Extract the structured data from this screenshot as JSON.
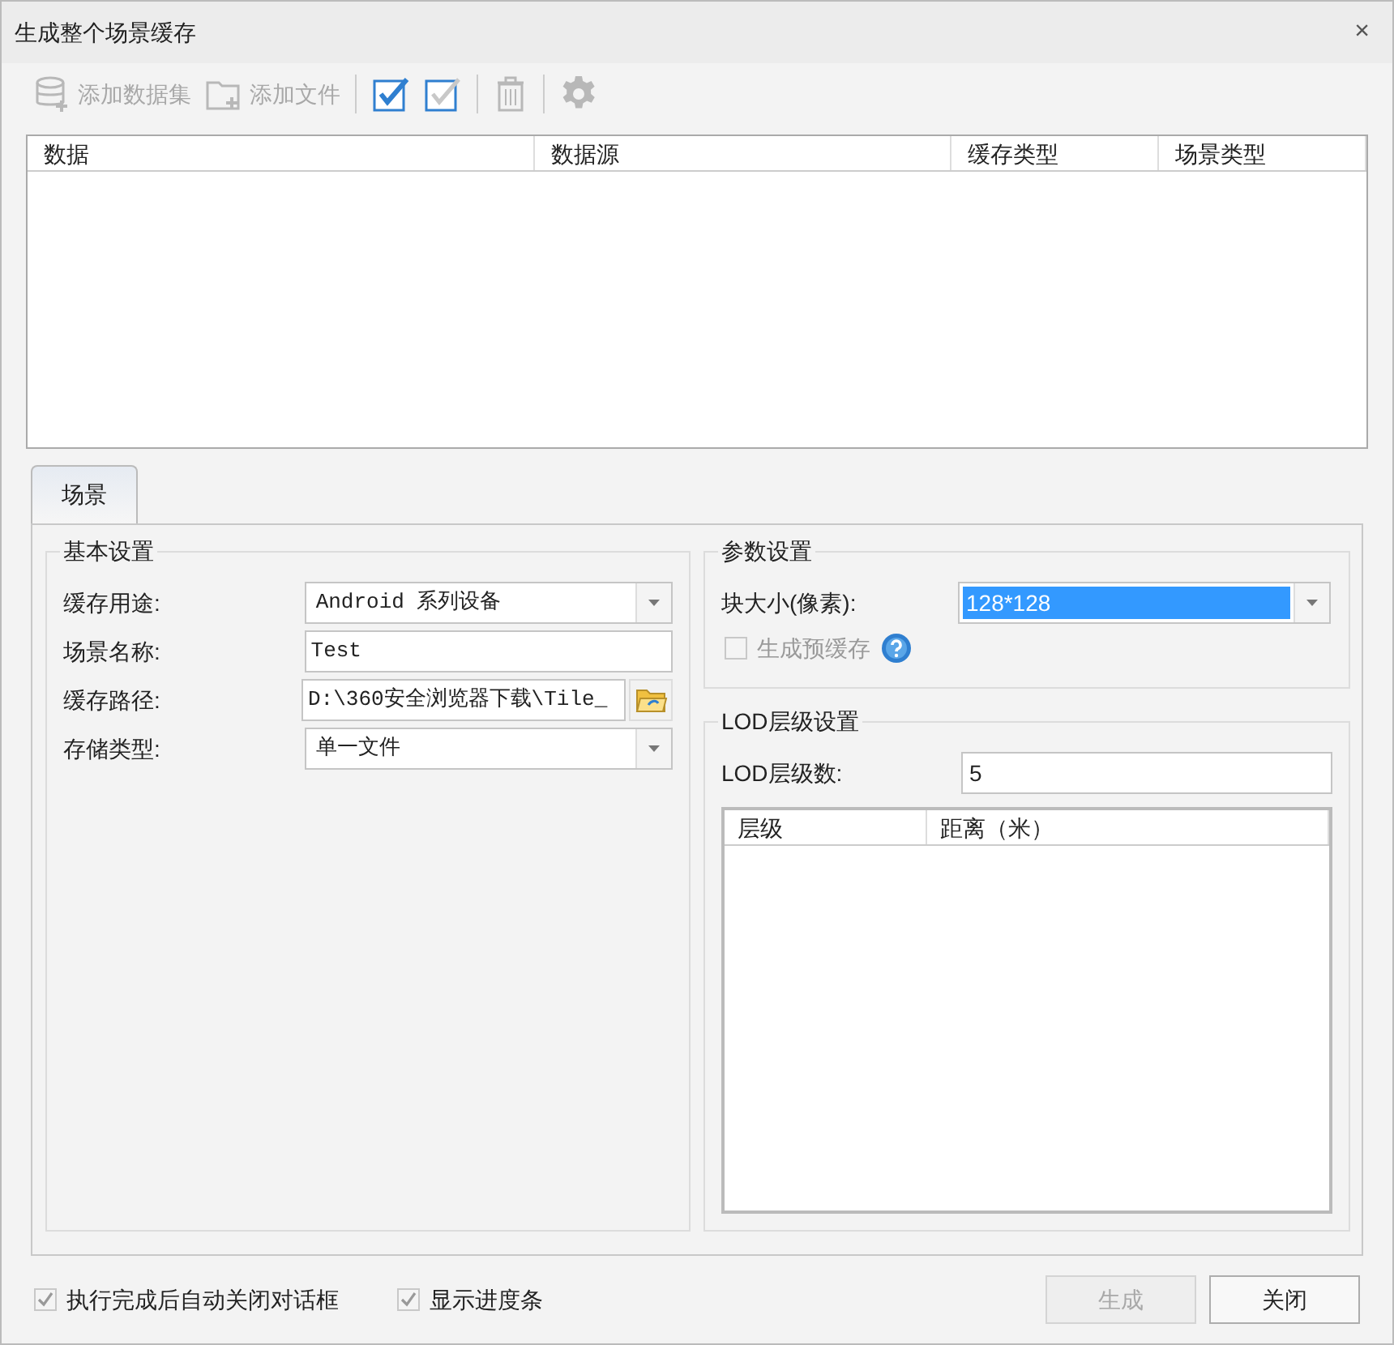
{
  "window": {
    "title": "生成整个场景缓存",
    "close": "×"
  },
  "toolbar": [
    {
      "kind": "database",
      "label": "添加数据集",
      "disabled": true
    },
    {
      "kind": "folder",
      "label": "添加文件",
      "disabled": true
    },
    {
      "kind": "select-all",
      "disabled": false
    },
    {
      "kind": "select-none",
      "disabled": false
    },
    {
      "kind": "delete",
      "disabled": true
    },
    {
      "kind": "settings",
      "disabled": true
    }
  ],
  "table": {
    "columns": [
      "数据",
      "数据源",
      "缓存类型",
      "场景类型"
    ]
  },
  "tabs": [
    {
      "label": "场景",
      "selected": true
    }
  ],
  "basic_settings": {
    "title": "基本设置",
    "fields": [
      {
        "kind": "dropdown",
        "label": "缓存用途:",
        "value": "Android 系列设备"
      },
      {
        "kind": "text",
        "label": "场景名称:",
        "value": "Test"
      },
      {
        "kind": "path",
        "label": "缓存路径:",
        "value": "D:\\360安全浏览器下载\\Tile_"
      },
      {
        "kind": "dropdown",
        "label": "存储类型:",
        "value": "单一文件"
      }
    ]
  },
  "param_settings": {
    "title": "参数设置",
    "block_size": {
      "label": "块大小(像素):",
      "value": "128*128",
      "highlighted": true
    },
    "precache": {
      "label": "生成预缓存",
      "checked": false,
      "disabled": true
    }
  },
  "lod_settings": {
    "title": "LOD层级设置",
    "count": {
      "label": "LOD层级数:",
      "value": "5"
    },
    "columns": [
      "层级",
      "距离（米）"
    ]
  },
  "footer": {
    "checkboxes": [
      {
        "label": "执行完成后自动关闭对话框",
        "checked": true,
        "disabled": true
      },
      {
        "label": "显示进度条",
        "checked": true,
        "disabled": true
      }
    ],
    "buttons": [
      {
        "label": "生成",
        "disabled": true
      },
      {
        "label": "关闭",
        "disabled": false
      }
    ]
  }
}
